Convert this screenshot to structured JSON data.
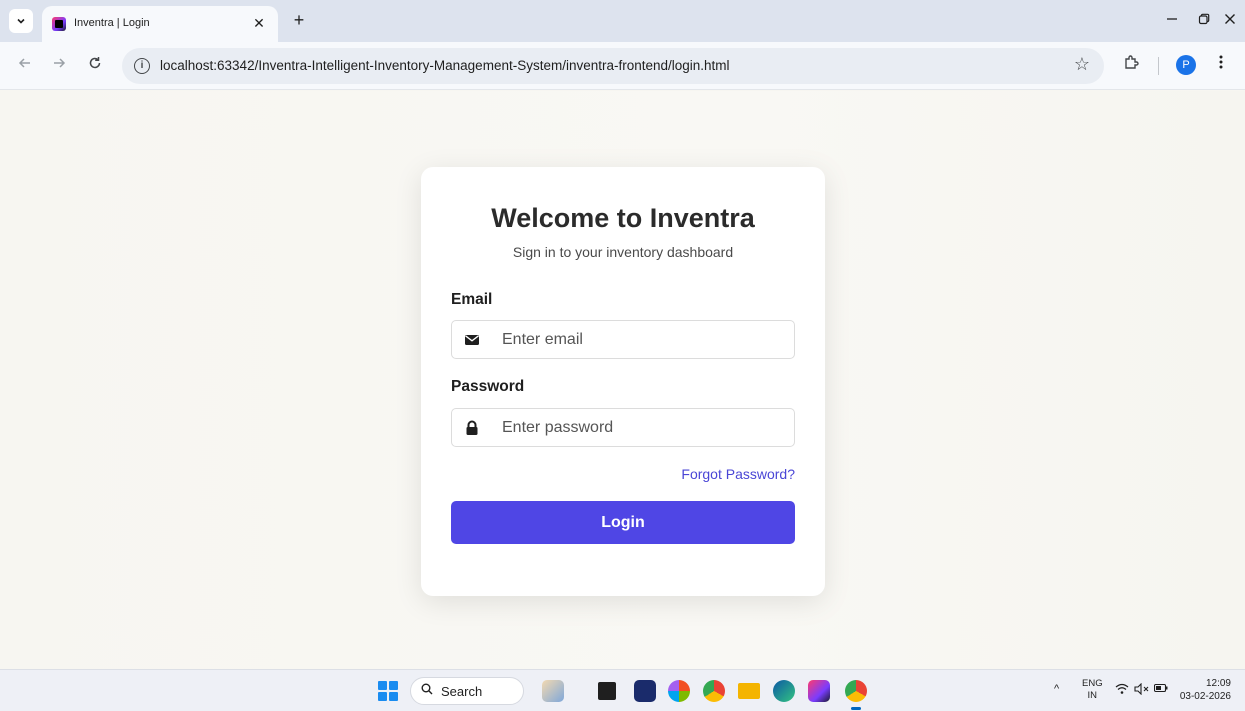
{
  "browser": {
    "tab_title": "Inventra | Login",
    "tab_close": "✕",
    "new_tab": "+",
    "url": "localhost:63342/Inventra-Intelligent-Inventory-Management-System/inventra-frontend/login.html",
    "profile_initial": "P"
  },
  "login": {
    "title": "Welcome to Inventra",
    "subtitle": "Sign in to your inventory dashboard",
    "email_label": "Email",
    "email_placeholder": "Enter email",
    "password_label": "Password",
    "password_placeholder": "Enter password",
    "forgot_link": "Forgot Password?",
    "login_button": "Login",
    "accent_color": "#4f46e5"
  },
  "taskbar": {
    "search_label": "Search",
    "lang_top": "ENG",
    "lang_bottom": "IN",
    "time": "12:09",
    "date": "03-02-2026"
  }
}
